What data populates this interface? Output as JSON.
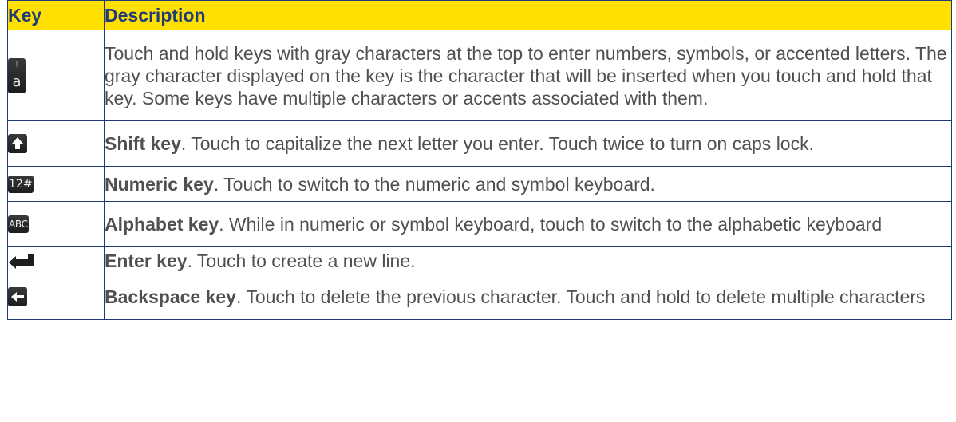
{
  "header": {
    "key": "Key",
    "description": "Description"
  },
  "rows": [
    {
      "icon": "gray-character-a-key-icon",
      "icon_gray": "!",
      "icon_main": "a",
      "bold": "",
      "text": "Touch and hold keys with gray characters at the top to enter numbers, symbols, or accented letters. The gray character displayed on the key is the character that will be inserted when you touch and hold that key. Some keys have multiple characters or accents associated with them."
    },
    {
      "icon": "shift-arrow-up-icon",
      "bold": "Shift key",
      "text": ". Touch to capitalize the next letter you enter. Touch twice to turn on caps lock."
    },
    {
      "icon": "numeric-12-hash-icon",
      "icon_text": "12#",
      "bold": "Numeric key",
      "text": ". Touch to switch to the numeric and symbol keyboard."
    },
    {
      "icon": "alphabet-abc-icon",
      "icon_text": "ABC",
      "bold": "Alphabet key",
      "text": ". While in numeric or symbol keyboard, touch to switch to the alphabetic keyboard"
    },
    {
      "icon": "enter-return-arrow-icon",
      "bold": "Enter key",
      "text": ". Touch to create a new line."
    },
    {
      "icon": "backspace-left-arrow-icon",
      "bold": "Backspace key",
      "text": ". Touch to delete the previous character. Touch and hold to delete multiple characters"
    }
  ],
  "colors": {
    "header_bg": "#ffe000",
    "header_text": "#1f3b78",
    "border": "#1f3b78",
    "body_text": "#505050",
    "key_bg": "#2a2a2a"
  }
}
